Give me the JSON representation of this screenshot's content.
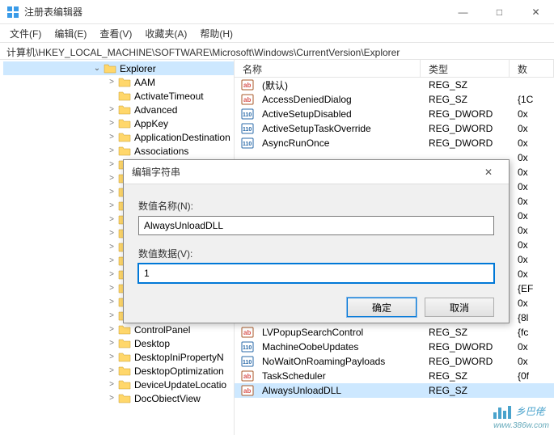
{
  "window": {
    "title": "注册表编辑器",
    "min": "—",
    "max": "□",
    "close": "✕"
  },
  "menu": {
    "file": "文件(F)",
    "edit": "编辑(E)",
    "view": "查看(V)",
    "fav": "收藏夹(A)",
    "help": "帮助(H)"
  },
  "address": "计算机\\HKEY_LOCAL_MACHINE\\SOFTWARE\\Microsoft\\Windows\\CurrentVersion\\Explorer",
  "tree": {
    "selected": "Explorer",
    "items": [
      {
        "indent": 110,
        "tw": "open",
        "label": "Explorer",
        "sel": true
      },
      {
        "indent": 128,
        "tw": "closed",
        "label": "AAM"
      },
      {
        "indent": 128,
        "tw": "none",
        "label": "ActivateTimeout"
      },
      {
        "indent": 128,
        "tw": "closed",
        "label": "Advanced"
      },
      {
        "indent": 128,
        "tw": "closed",
        "label": "AppKey"
      },
      {
        "indent": 128,
        "tw": "closed",
        "label": "ApplicationDestination"
      },
      {
        "indent": 128,
        "tw": "closed",
        "label": "Associations"
      },
      {
        "indent": 128,
        "tw": "closed",
        "label": ""
      },
      {
        "indent": 128,
        "tw": "closed",
        "label": ""
      },
      {
        "indent": 128,
        "tw": "closed",
        "label": ""
      },
      {
        "indent": 128,
        "tw": "closed",
        "label": ""
      },
      {
        "indent": 128,
        "tw": "closed",
        "label": ""
      },
      {
        "indent": 128,
        "tw": "closed",
        "label": ""
      },
      {
        "indent": 128,
        "tw": "closed",
        "label": ""
      },
      {
        "indent": 128,
        "tw": "closed",
        "label": ""
      },
      {
        "indent": 128,
        "tw": "closed",
        "label": ""
      },
      {
        "indent": 128,
        "tw": "closed",
        "label": ""
      },
      {
        "indent": 128,
        "tw": "closed",
        "label": ""
      },
      {
        "indent": 128,
        "tw": "closed",
        "label": "CommonPlaces"
      },
      {
        "indent": 128,
        "tw": "closed",
        "label": "ControlPanel"
      },
      {
        "indent": 128,
        "tw": "closed",
        "label": "Desktop"
      },
      {
        "indent": 128,
        "tw": "closed",
        "label": "DesktopIniPropertyN"
      },
      {
        "indent": 128,
        "tw": "closed",
        "label": "DesktopOptimization"
      },
      {
        "indent": 128,
        "tw": "closed",
        "label": "DeviceUpdateLocatio"
      },
      {
        "indent": 128,
        "tw": "closed",
        "label": "DocObiectView"
      }
    ]
  },
  "list": {
    "headers": {
      "name": "名称",
      "type": "类型",
      "data": "数"
    },
    "data_header_sub": "(数",
    "rows": [
      {
        "icon": "str",
        "name": "(默认)",
        "type": "REG_SZ",
        "data": ""
      },
      {
        "icon": "str",
        "name": "AccessDeniedDialog",
        "type": "REG_SZ",
        "data": "{1C"
      },
      {
        "icon": "bin",
        "name": "ActiveSetupDisabled",
        "type": "REG_DWORD",
        "data": "0x"
      },
      {
        "icon": "bin",
        "name": "ActiveSetupTaskOverride",
        "type": "REG_DWORD",
        "data": "0x"
      },
      {
        "icon": "bin",
        "name": "AsyncRunOnce",
        "type": "REG_DWORD",
        "data": "0x"
      },
      {
        "icon": "",
        "name": "",
        "type": "",
        "data": "0x"
      },
      {
        "icon": "",
        "name": "",
        "type": "",
        "data": "0x"
      },
      {
        "icon": "",
        "name": "",
        "type": "",
        "data": "0x"
      },
      {
        "icon": "",
        "name": "",
        "type": "",
        "data": "0x"
      },
      {
        "icon": "",
        "name": "",
        "type": "",
        "data": "0x"
      },
      {
        "icon": "",
        "name": "",
        "type": "",
        "data": "0x"
      },
      {
        "icon": "",
        "name": "",
        "type": "",
        "data": "0x"
      },
      {
        "icon": "",
        "name": "",
        "type": "",
        "data": "0x"
      },
      {
        "icon": "",
        "name": "",
        "type": "",
        "data": "0x"
      },
      {
        "icon": "",
        "name": "",
        "type": "",
        "data": "{EF"
      },
      {
        "icon": "",
        "name": "",
        "type": "",
        "data": "0x"
      },
      {
        "icon": "",
        "name": "",
        "type": "",
        "data": "{8l"
      },
      {
        "icon": "str",
        "name": "LVPopupSearchControl",
        "type": "REG_SZ",
        "data": "{fc"
      },
      {
        "icon": "bin",
        "name": "MachineOobeUpdates",
        "type": "REG_DWORD",
        "data": "0x"
      },
      {
        "icon": "bin",
        "name": "NoWaitOnRoamingPayloads",
        "type": "REG_DWORD",
        "data": "0x"
      },
      {
        "icon": "str",
        "name": "TaskScheduler",
        "type": "REG_SZ",
        "data": "{0f"
      },
      {
        "icon": "str",
        "name": "AlwaysUnloadDLL",
        "type": "REG_SZ",
        "data": "",
        "sel": true
      }
    ]
  },
  "dialog": {
    "title": "编辑字符串",
    "close": "✕",
    "name_label": "数值名称(N):",
    "name_value": "AlwaysUnloadDLL",
    "data_label": "数值数据(V):",
    "data_value": "1",
    "ok": "确定",
    "cancel": "取消"
  },
  "watermark": {
    "text": "乡巴佬",
    "url": "www.386w.com"
  }
}
